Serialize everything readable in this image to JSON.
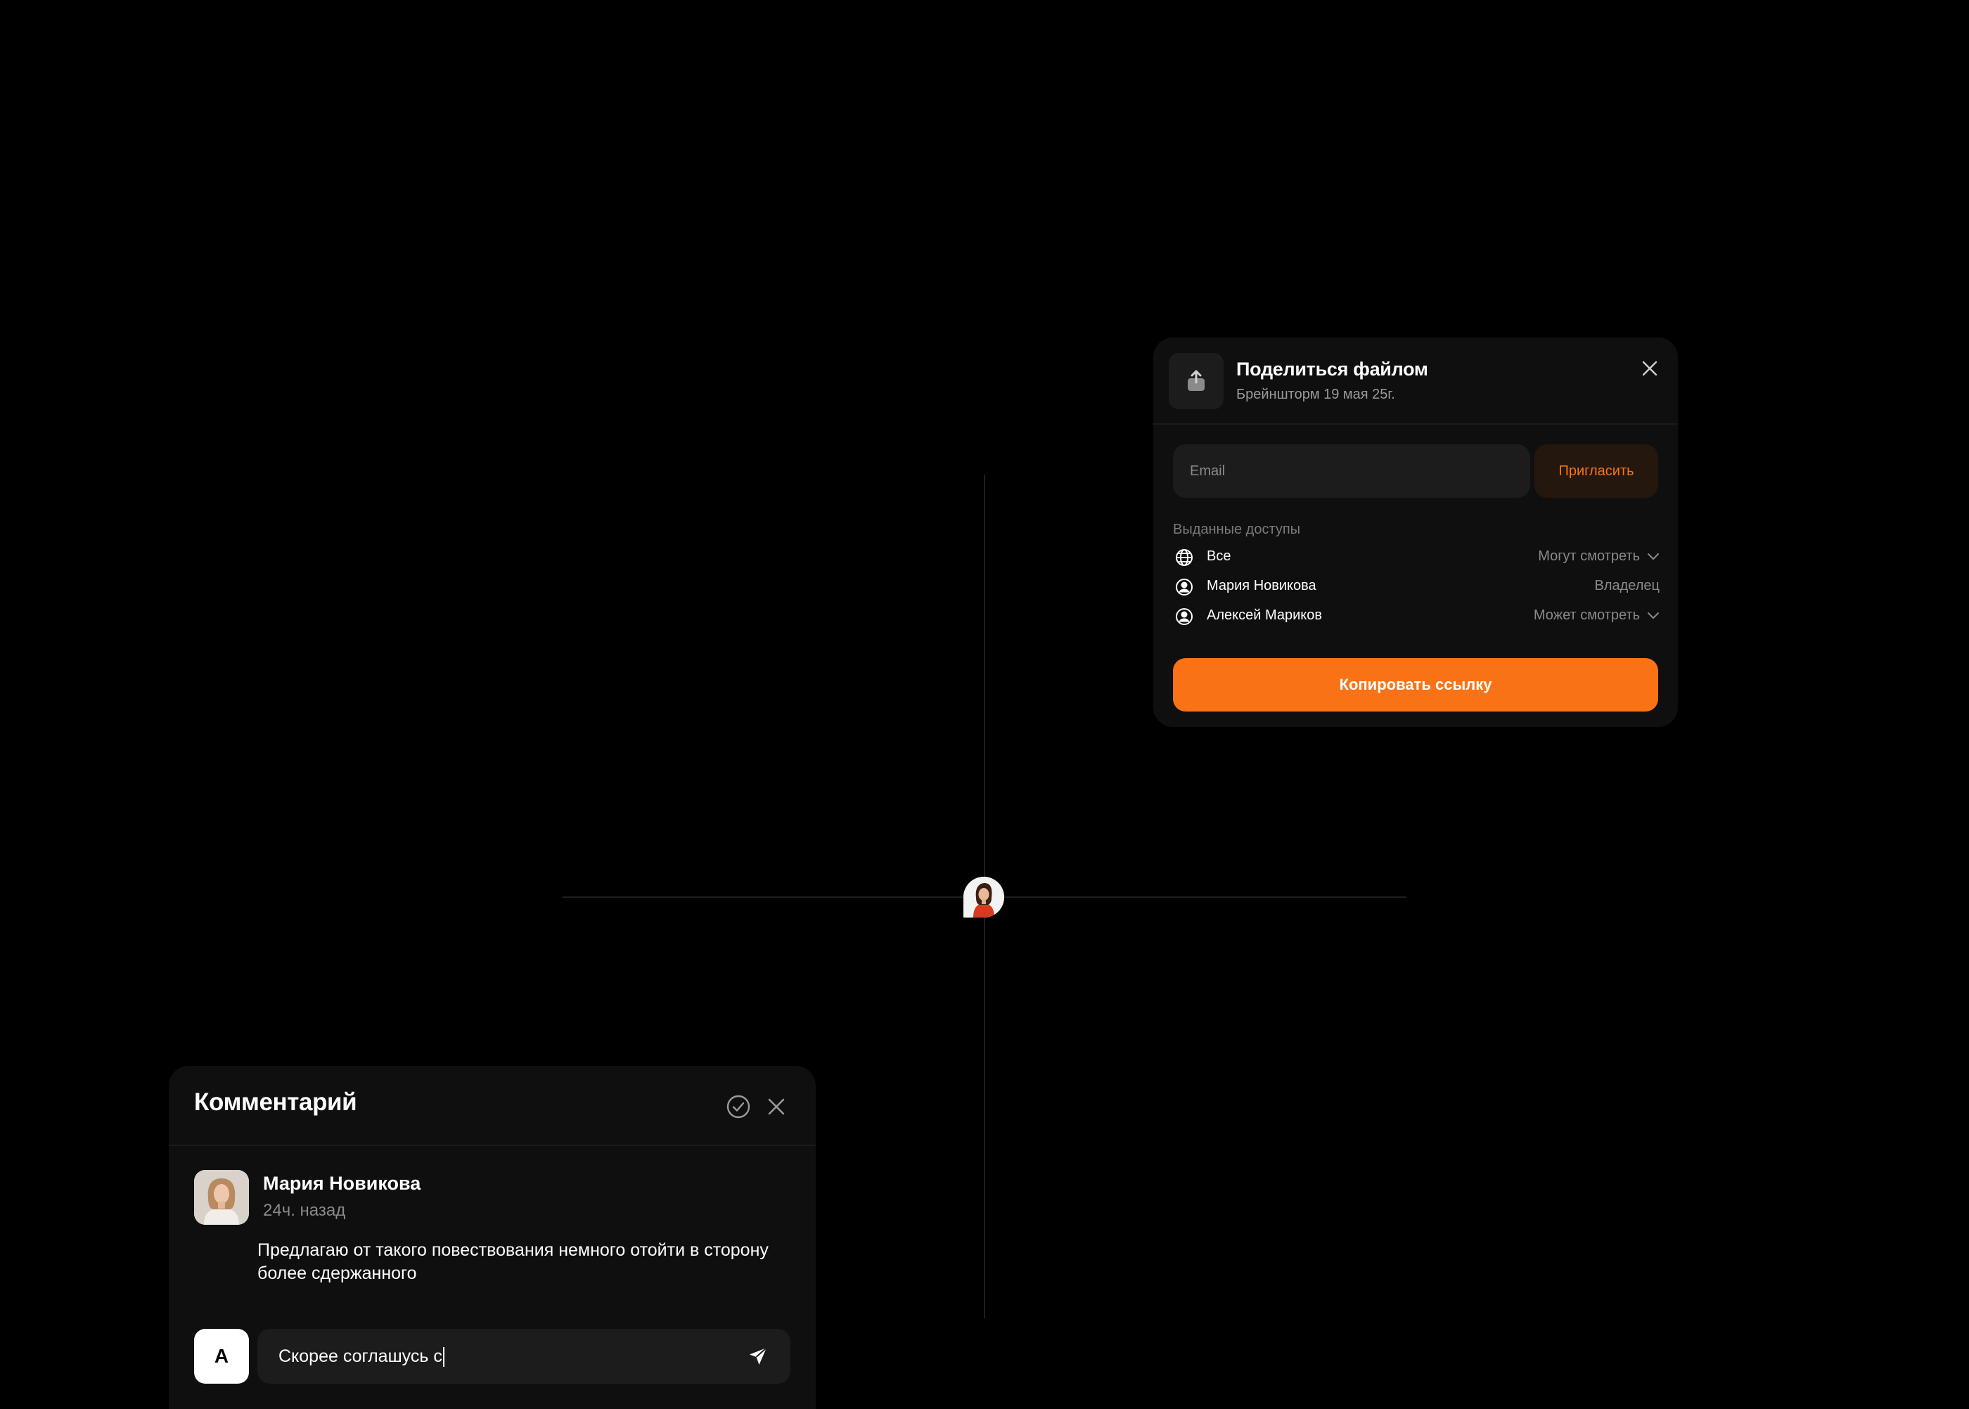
{
  "share_dialog": {
    "title": "Поделиться файлом",
    "subtitle": "Брейншторм 19 мая 25г.",
    "email_placeholder": "Email",
    "invite_label": "Пригласить",
    "access_caption": "Выданные доступы",
    "access": [
      {
        "name": "Все",
        "role": "Могут смотреть",
        "icon": "globe-icon",
        "has_dropdown": true
      },
      {
        "name": "Мария Новикова",
        "role": "Владелец",
        "icon": "user-circle-icon",
        "has_dropdown": false
      },
      {
        "name": "Алексей Мариков",
        "role": "Может смотреть",
        "icon": "user-circle-icon",
        "has_dropdown": true
      }
    ],
    "copy_link_label": "Копировать ссылку",
    "header_icon": "upload-icon",
    "close_icon": "close-icon"
  },
  "comment_panel": {
    "title": "Комментарий",
    "resolve_icon": "check-circle-icon",
    "close_icon": "close-icon",
    "author_name": "Мария Новикова",
    "time": "24ч. назад",
    "text": "Предлагаю от такого повествования немного отойти в сторону более сдержанного",
    "reply_avatar_letter": "А",
    "reply_value": "Скорее соглашусь с",
    "send_icon": "send-icon"
  },
  "colors": {
    "background": "#000000",
    "panel": "#0f0f0f",
    "field": "#1c1c1c",
    "accent": "#f97316",
    "muted_text": "#8a8a8a"
  }
}
